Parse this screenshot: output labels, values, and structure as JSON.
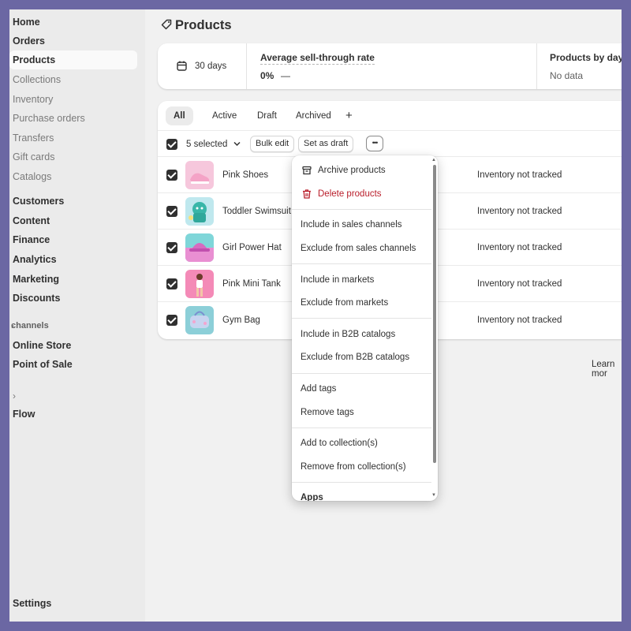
{
  "sidebar": {
    "items": [
      {
        "label": "Home",
        "style": "bold"
      },
      {
        "label": "Orders",
        "style": "bold"
      },
      {
        "label": "Products",
        "style": "active"
      },
      {
        "label": "Collections",
        "style": "sub"
      },
      {
        "label": "Inventory",
        "style": "sub"
      },
      {
        "label": "Purchase orders",
        "style": "sub"
      },
      {
        "label": "Transfers",
        "style": "sub"
      },
      {
        "label": "Gift cards",
        "style": "sub"
      },
      {
        "label": "Catalogs",
        "style": "sub"
      },
      {
        "label": "Customers",
        "style": "bold"
      },
      {
        "label": "Content",
        "style": "bold"
      },
      {
        "label": "Finance",
        "style": "bold"
      },
      {
        "label": "Analytics",
        "style": "bold"
      },
      {
        "label": "Marketing",
        "style": "bold"
      },
      {
        "label": "Discounts",
        "style": "bold"
      }
    ],
    "channels_label": "channels",
    "channels": [
      {
        "label": "Online Store"
      },
      {
        "label": "Point of Sale"
      }
    ],
    "flow_label": "Flow",
    "settings_label": "Settings"
  },
  "page": {
    "title": "Products"
  },
  "stats": {
    "date_range": "30 days",
    "avg_title": "Average sell-through rate",
    "avg_value": "0%",
    "avg_dash": "—",
    "by_days_title": "Products by days",
    "by_days_value": "No data"
  },
  "tabs": [
    {
      "label": "All",
      "active": true
    },
    {
      "label": "Active",
      "active": false
    },
    {
      "label": "Draft",
      "active": false
    },
    {
      "label": "Archived",
      "active": false
    },
    {
      "label": "+",
      "active": false
    }
  ],
  "bulk": {
    "selected_label": "5 selected",
    "bulk_edit_label": "Bulk edit",
    "set_draft_label": "Set as draft",
    "more_label": "•••"
  },
  "products": [
    {
      "name": "Pink Shoes",
      "inventory": "Inventory not tracked",
      "thumb_color": "#f6c7dc"
    },
    {
      "name": "Toddler Swimsuit",
      "inventory": "Inventory not tracked",
      "thumb_color": "#9bd6d2"
    },
    {
      "name": "Girl Power Hat",
      "inventory": "Inventory not tracked",
      "thumb_color": "#e98fd2"
    },
    {
      "name": "Pink Mini Tank",
      "inventory": "Inventory not tracked",
      "thumb_color": "#f48ab7"
    },
    {
      "name": "Gym Bag",
      "inventory": "Inventory not tracked",
      "thumb_color": "#8ccfd8"
    }
  ],
  "learn_more": "Learn mor",
  "menu": {
    "archive": "Archive products",
    "delete": "Delete products",
    "include_sales": "Include in sales channels",
    "exclude_sales": "Exclude from sales channels",
    "include_markets": "Include in markets",
    "exclude_markets": "Exclude from markets",
    "include_b2b": "Include in B2B catalogs",
    "exclude_b2b": "Exclude from B2B catalogs",
    "add_tags": "Add tags",
    "remove_tags": "Remove tags",
    "add_collection": "Add to collection(s)",
    "remove_collection": "Remove from collection(s)",
    "apps": "Apps"
  },
  "colors": {
    "frame_bg": "#6b67a3",
    "danger": "#b91d2a",
    "checkbox": "#303030"
  }
}
